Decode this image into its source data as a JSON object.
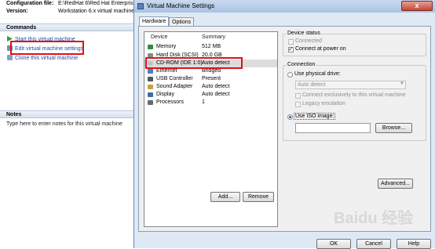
{
  "vm_info": {
    "config_label": "Configuration file:",
    "config_value": "E:\\RedHat 6\\Red Hat Enterprise",
    "version_label": "Version:",
    "version_value": "Workstation 6.x virtual machine"
  },
  "commands": {
    "title": "Commands",
    "items": [
      {
        "label": "Start this virtual machine"
      },
      {
        "label": "Edit virtual machine settings"
      },
      {
        "label": "Clone this virtual machine"
      }
    ]
  },
  "notes": {
    "title": "Notes",
    "placeholder": "Type here to enter notes for this virtual machine"
  },
  "dialog": {
    "title": "Virtual Machine Settings",
    "close_label": "x",
    "tabs": [
      {
        "label": "Hardware"
      },
      {
        "label": "Options"
      }
    ],
    "list_headers": {
      "device": "Device",
      "summary": "Summary"
    },
    "devices": [
      {
        "name": "Memory",
        "summary": "512 MB",
        "icon": "memory-icon"
      },
      {
        "name": "Hard Disk (SCSI)",
        "summary": "20.0 GB",
        "icon": "hard-disk-icon"
      },
      {
        "name": "CD-ROM (IDE 1:0)",
        "summary": "Auto detect",
        "icon": "cd-rom-icon"
      },
      {
        "name": "Ethernet",
        "summary": "Bridged",
        "icon": "ethernet-icon"
      },
      {
        "name": "USB Controller",
        "summary": "Present",
        "icon": "usb-icon"
      },
      {
        "name": "Sound Adapter",
        "summary": "Auto detect",
        "icon": "sound-icon"
      },
      {
        "name": "Display",
        "summary": "Auto detect",
        "icon": "display-icon"
      },
      {
        "name": "Processors",
        "summary": "1",
        "icon": "processor-icon"
      }
    ],
    "add_button": "Add...",
    "remove_button": "Remove",
    "device_status": {
      "title": "Device status",
      "connected": "Connected",
      "connect_at_power_on": "Connect at power on"
    },
    "connection": {
      "title": "Connection",
      "use_physical_drive": "Use physical drive:",
      "drive_value": "Auto detect",
      "connect_exclusively": "Connect exclusively to this virtual machine",
      "legacy_emulation": "Legacy emulation",
      "use_iso_image": "Use ISO image:",
      "iso_value": "",
      "browse_button": "Browse..."
    },
    "advanced_button": "Advanced...",
    "ok_button": "OK",
    "cancel_button": "Cancel",
    "help_button": "Help"
  },
  "watermark": "Baidu 经验",
  "colors": {
    "highlight": "#e0101a",
    "link": "#1a4fa8"
  }
}
